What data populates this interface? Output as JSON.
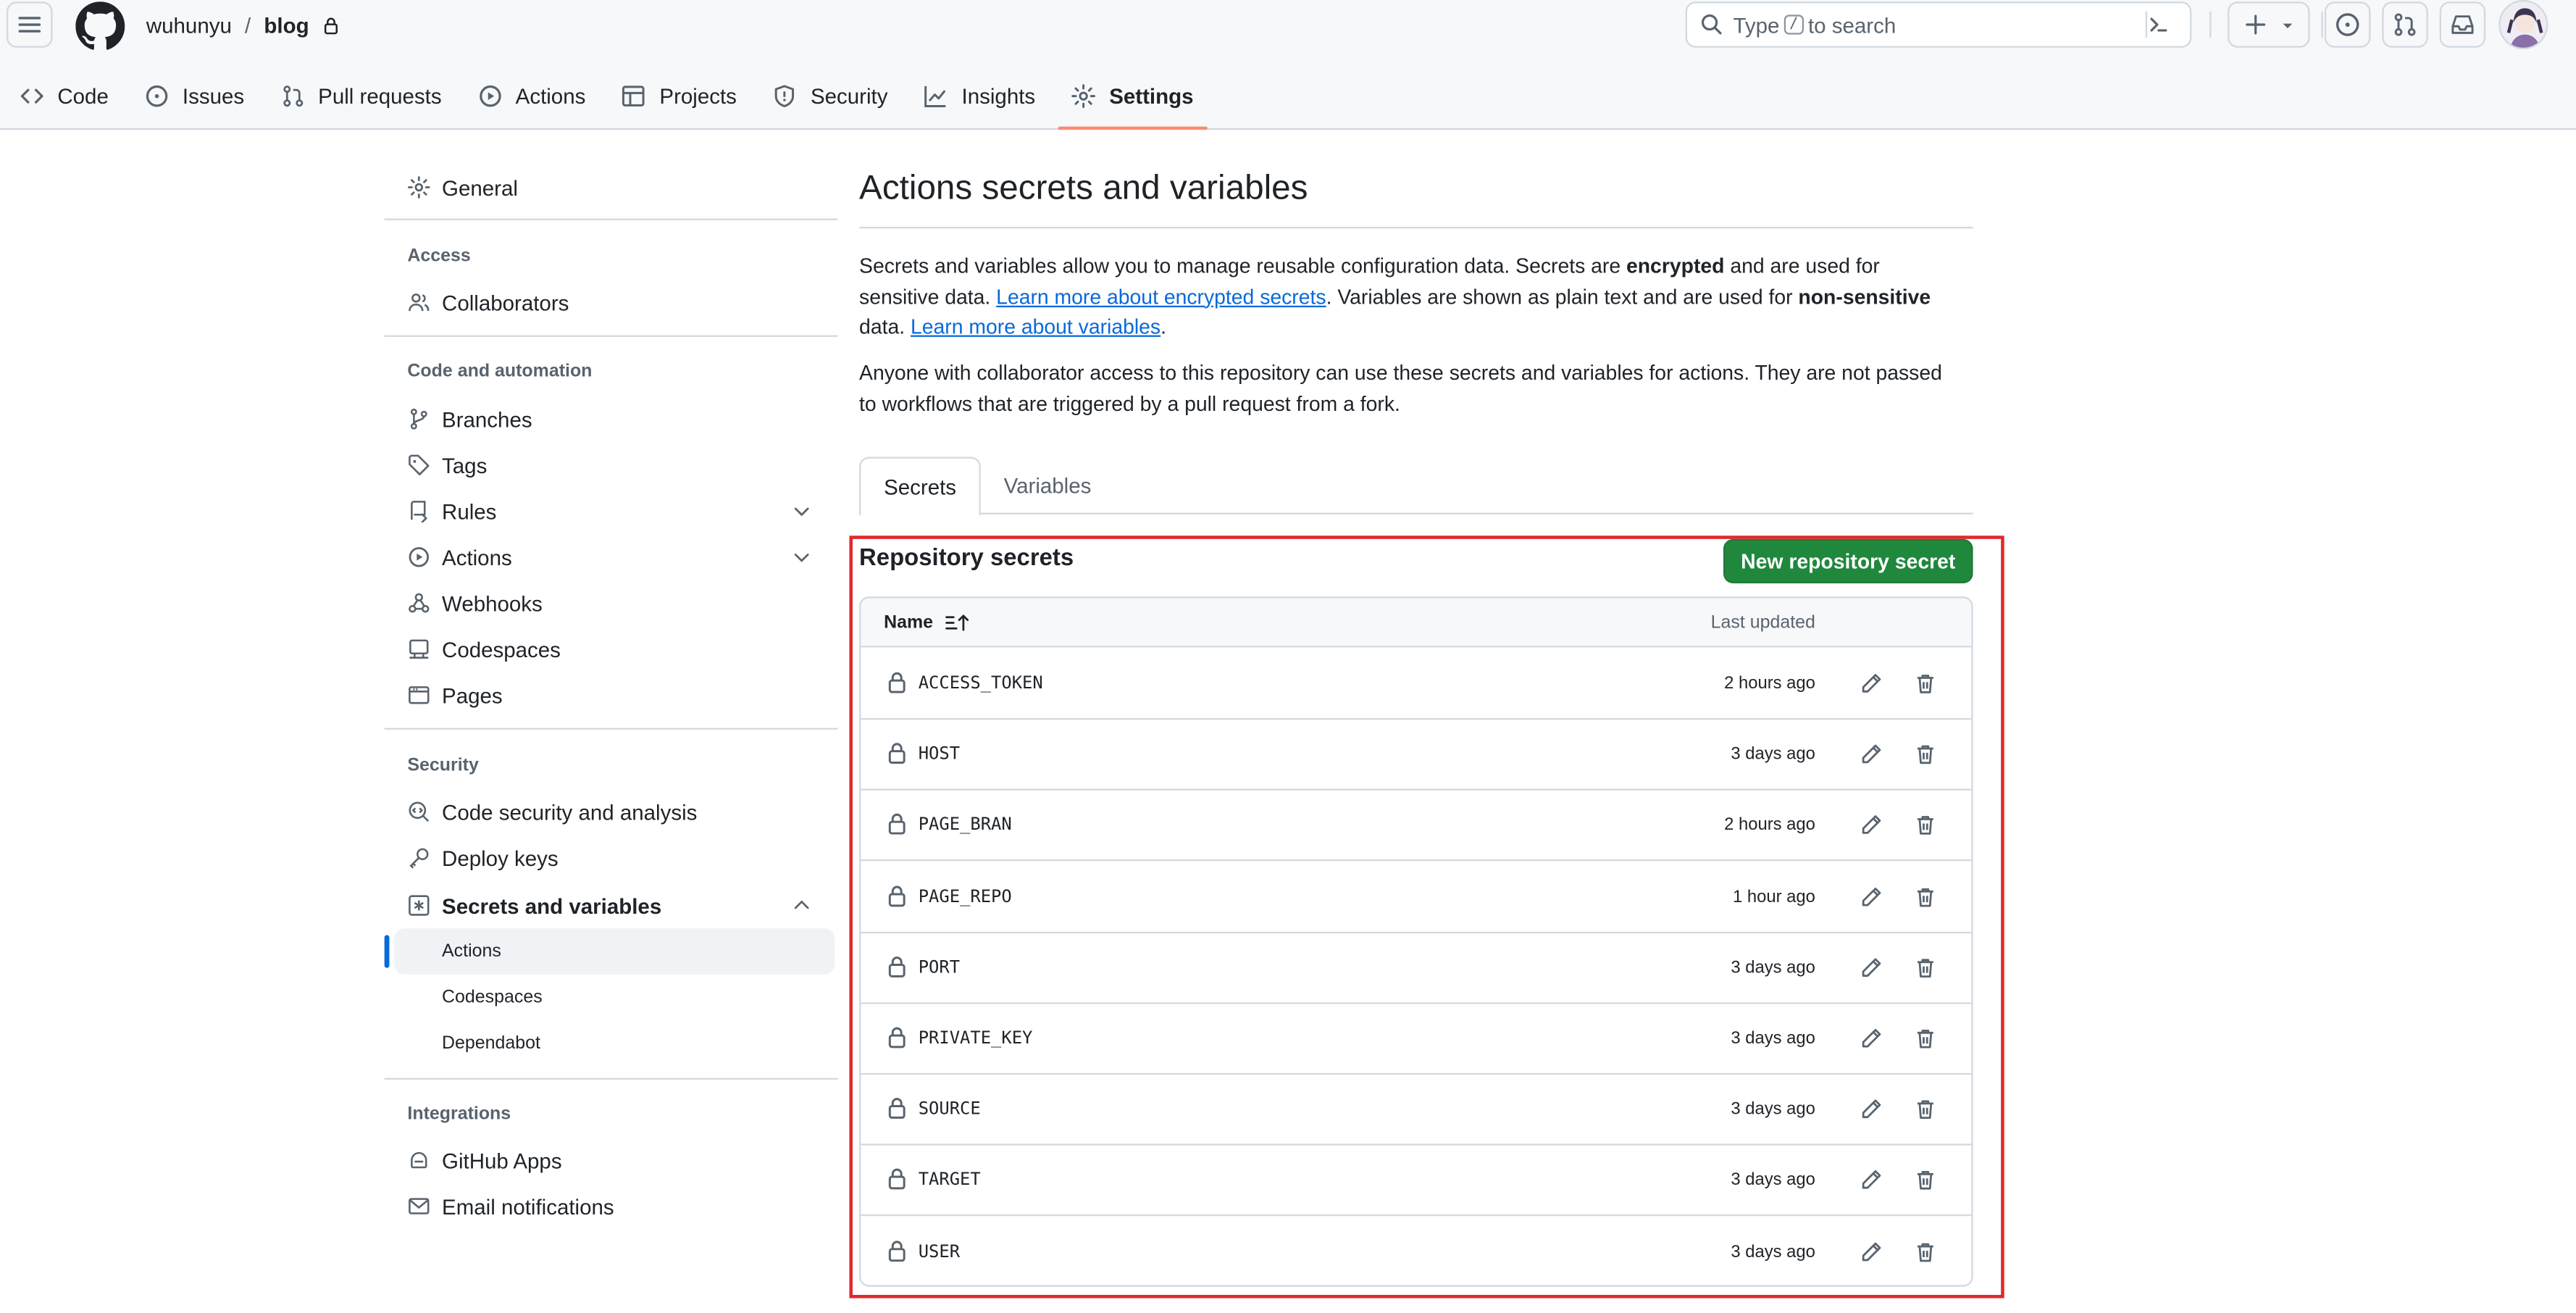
{
  "header": {
    "owner": "wuhunyu",
    "separator": "/",
    "repo": "blog",
    "search": {
      "before": "Type",
      "key": "/",
      "after": "to search"
    }
  },
  "repo_tabs": [
    {
      "label": "Code",
      "icon": "code-icon"
    },
    {
      "label": "Issues",
      "icon": "issue-icon"
    },
    {
      "label": "Pull requests",
      "icon": "pull-request-icon"
    },
    {
      "label": "Actions",
      "icon": "play-icon"
    },
    {
      "label": "Projects",
      "icon": "table-icon"
    },
    {
      "label": "Security",
      "icon": "shield-icon"
    },
    {
      "label": "Insights",
      "icon": "graph-icon"
    },
    {
      "label": "Settings",
      "icon": "gear-icon",
      "selected": true
    }
  ],
  "sidebar": {
    "general": "General",
    "access_heading": "Access",
    "collaborators": "Collaborators",
    "code_heading": "Code and automation",
    "branches": "Branches",
    "tags": "Tags",
    "rules": "Rules",
    "actions": "Actions",
    "webhooks": "Webhooks",
    "codespaces": "Codespaces",
    "pages": "Pages",
    "security_heading": "Security",
    "code_security": "Code security and analysis",
    "deploy_keys": "Deploy keys",
    "secrets_and_variables": "Secrets and variables",
    "sub_actions": "Actions",
    "sub_codespaces": "Codespaces",
    "sub_dependabot": "Dependabot",
    "integrations_heading": "Integrations",
    "github_apps": "GitHub Apps",
    "email_notifications": "Email notifications"
  },
  "main": {
    "title": "Actions secrets and variables",
    "intro": {
      "p1": "Secrets and variables allow you to manage reusable configuration data. Secrets are ",
      "b1": "encrypted",
      "p2": " and are used for sensitive data. ",
      "link1": "Learn more about encrypted secrets",
      "p3": ". Variables are shown as plain text and are used for ",
      "b2": "non-sensitive",
      "p4": " data. ",
      "link2": "Learn more about variables",
      "p5": "."
    },
    "access_note": "Anyone with collaborator access to this repository can use these secrets and variables for actions. They are not passed to workflows that are triggered by a pull request from a fork.",
    "tabs": {
      "secrets": "Secrets",
      "variables": "Variables"
    },
    "section_title": "Repository secrets",
    "new_button": "New repository secret",
    "table": {
      "col_name": "Name",
      "col_updated": "Last updated",
      "rows": [
        {
          "name": "ACCESS_TOKEN",
          "updated": "2 hours ago"
        },
        {
          "name": "HOST",
          "updated": "3 days ago"
        },
        {
          "name": "PAGE_BRAN",
          "updated": "2 hours ago"
        },
        {
          "name": "PAGE_REPO",
          "updated": "1 hour ago"
        },
        {
          "name": "PORT",
          "updated": "3 days ago"
        },
        {
          "name": "PRIVATE_KEY",
          "updated": "3 days ago"
        },
        {
          "name": "SOURCE",
          "updated": "3 days ago"
        },
        {
          "name": "TARGET",
          "updated": "3 days ago"
        },
        {
          "name": "USER",
          "updated": "3 days ago"
        }
      ]
    }
  },
  "colors": {
    "accent_link": "#0969da",
    "primary_button": "#1f883d",
    "tab_underline": "#fd8c73",
    "highlight_box": "#e0282b"
  }
}
